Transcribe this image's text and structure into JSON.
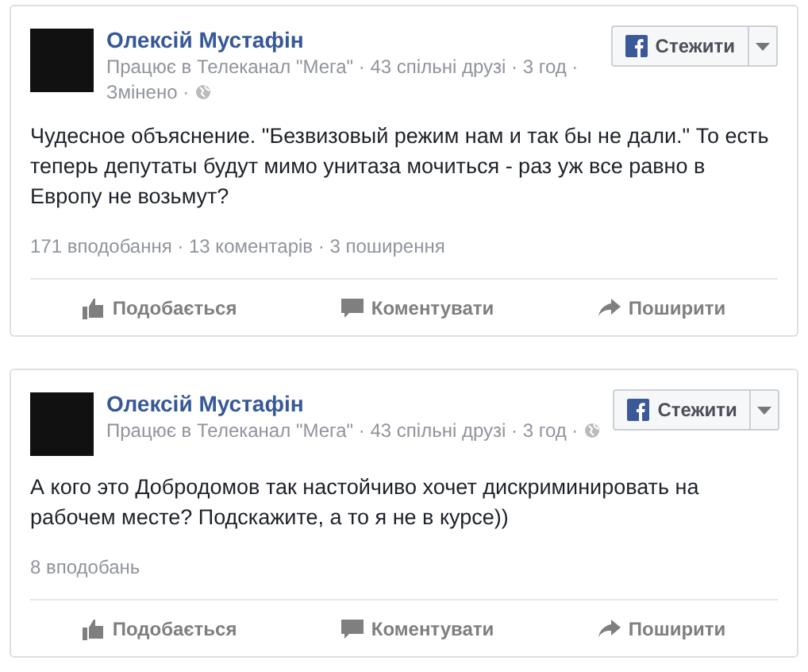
{
  "posts": [
    {
      "author": "Олексій Мустафін",
      "meta_lines": [
        "Працює в Телеканал \"Мега\" · 43 спільні друзі · 3 год ·",
        "Змінено ·"
      ],
      "follow": "Стежити",
      "text": "Чудесное объяснение. \"Безвизовый режим нам и так бы не дали.\" То есть теперь депутаты будут мимо унитаза мочиться - раз уж все равно в Европу не возьмут?",
      "stats": "171 вподобання · 13 коментарів · 3 поширення",
      "actions": [
        {
          "kind": "like",
          "label": "Подобається"
        },
        {
          "kind": "comment",
          "label": "Коментувати"
        },
        {
          "kind": "share",
          "label": "Поширити"
        }
      ]
    },
    {
      "author": "Олексій Мустафін",
      "meta_lines": [
        "Працює в Телеканал \"Мега\" · 43 спільні друзі · 3 год ·"
      ],
      "follow": "Стежити",
      "text": "А кого это Добродомов так настойчиво хочет дискриминировать на рабочем месте? Подскажите, а то я не в курсе))",
      "stats": "8 вподобань",
      "actions": [
        {
          "kind": "like",
          "label": "Подобається"
        },
        {
          "kind": "comment",
          "label": "Коментувати"
        },
        {
          "kind": "share",
          "label": "Поширити"
        }
      ]
    }
  ]
}
